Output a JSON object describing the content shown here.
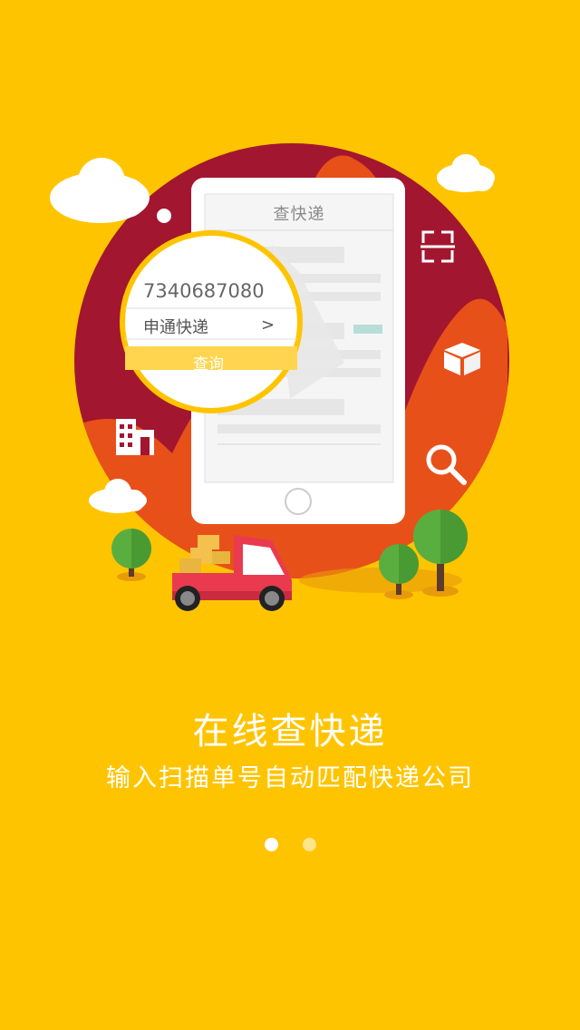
{
  "illustration": {
    "phone_title": "查快递",
    "tracking_number": "7340687080",
    "company_name": "申通快递",
    "chevron": ">",
    "query_button": "查询"
  },
  "headline": "在线查快递",
  "subline": "输入扫描单号自动匹配快递公司",
  "pagination": {
    "total": 2,
    "active": 1
  },
  "colors": {
    "background": "#FFC400",
    "circle_dark": "#A3162F",
    "circle_orange": "#E8501A",
    "truck": "#E93A4F",
    "tree": "#5AAE3F"
  }
}
